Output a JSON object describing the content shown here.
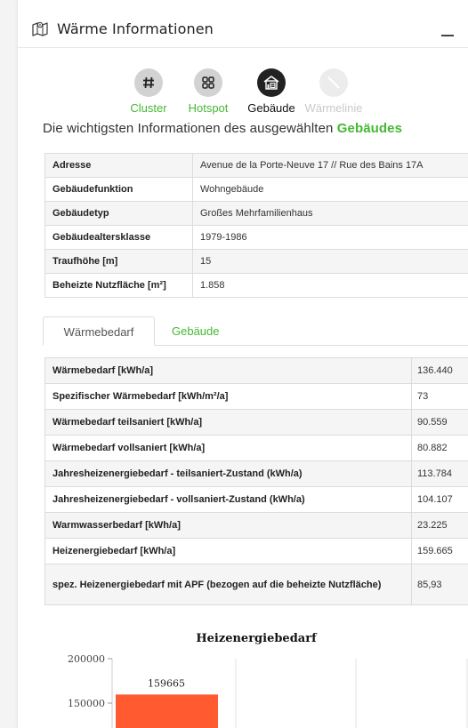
{
  "panel": {
    "title": "Wärme Informationen",
    "minimize_label": "—",
    "map_icon": "map-icon"
  },
  "tools": [
    {
      "label": "Cluster",
      "icon": "hash-icon",
      "state": "inactive"
    },
    {
      "label": "Hotspot",
      "icon": "grid-icon",
      "state": "inactive"
    },
    {
      "label": "Gebäude",
      "icon": "building-icon",
      "state": "active"
    },
    {
      "label": "Wärmelinie",
      "icon": "line-icon",
      "state": "disabled"
    }
  ],
  "headline": {
    "prefix": "Die wichtigsten Informationen des ausgewählten ",
    "highlight": "Gebäudes"
  },
  "info_rows": [
    {
      "key": "Adresse",
      "value": "Avenue de la Porte-Neuve 17 // Rue des Bains 17A"
    },
    {
      "key": "Gebäudefunktion",
      "value": "Wohngebäude"
    },
    {
      "key": "Gebäudetyp",
      "value": "Großes Mehrfamilienhaus"
    },
    {
      "key": "Gebäudealtersklasse",
      "value": "1979-1986"
    },
    {
      "key": "Traufhöhe [m]",
      "value": "15"
    },
    {
      "key": "Beheizte Nutzfläche [m²]",
      "value": "1.858"
    }
  ],
  "tabs": [
    {
      "label": "Wärmebedarf",
      "active": true
    },
    {
      "label": "Gebäude",
      "active": false
    }
  ],
  "demand_rows": [
    {
      "key": "Wärmebedarf [kWh/a]",
      "value": "136.440"
    },
    {
      "key": "Spezifischer Wärmebedarf [kWh/m²/a]",
      "value": "73"
    },
    {
      "key": "Wärmebedarf teilsaniert [kWh/a]",
      "value": "90.559"
    },
    {
      "key": "Wärmebedarf vollsaniert [kWh/a]",
      "value": "80.882"
    },
    {
      "key": "Jahresheizenergiebedarf - teilsaniert-Zustand (kWh/a)",
      "value": "113.784"
    },
    {
      "key": "Jahresheizenergiebedarf - vollsaniert-Zustand (kWh/a)",
      "value": "104.107"
    },
    {
      "key": "Warmwasserbedarf [kWh/a]",
      "value": "23.225"
    },
    {
      "key": "Heizenergiebedarf [kWh/a]",
      "value": "159.665"
    },
    {
      "key": "spez. Heizenergiebedarf mit APF (bezogen auf die beheizte Nutzfläche)",
      "value": "85,93"
    }
  ],
  "chart_data": {
    "type": "bar",
    "title": "Heizenergiebedarf",
    "categories": [
      ""
    ],
    "values": [
      159665
    ],
    "data_labels": [
      "159665"
    ],
    "ytick_labels": [
      "200000",
      "150000"
    ],
    "yticks": [
      200000,
      150000
    ],
    "ylim_visible": [
      142000,
      200000
    ],
    "bar_color": "#ff5a30",
    "grid": true
  },
  "colors": {
    "accent_green": "#45b833",
    "bar": "#ff5a30"
  }
}
